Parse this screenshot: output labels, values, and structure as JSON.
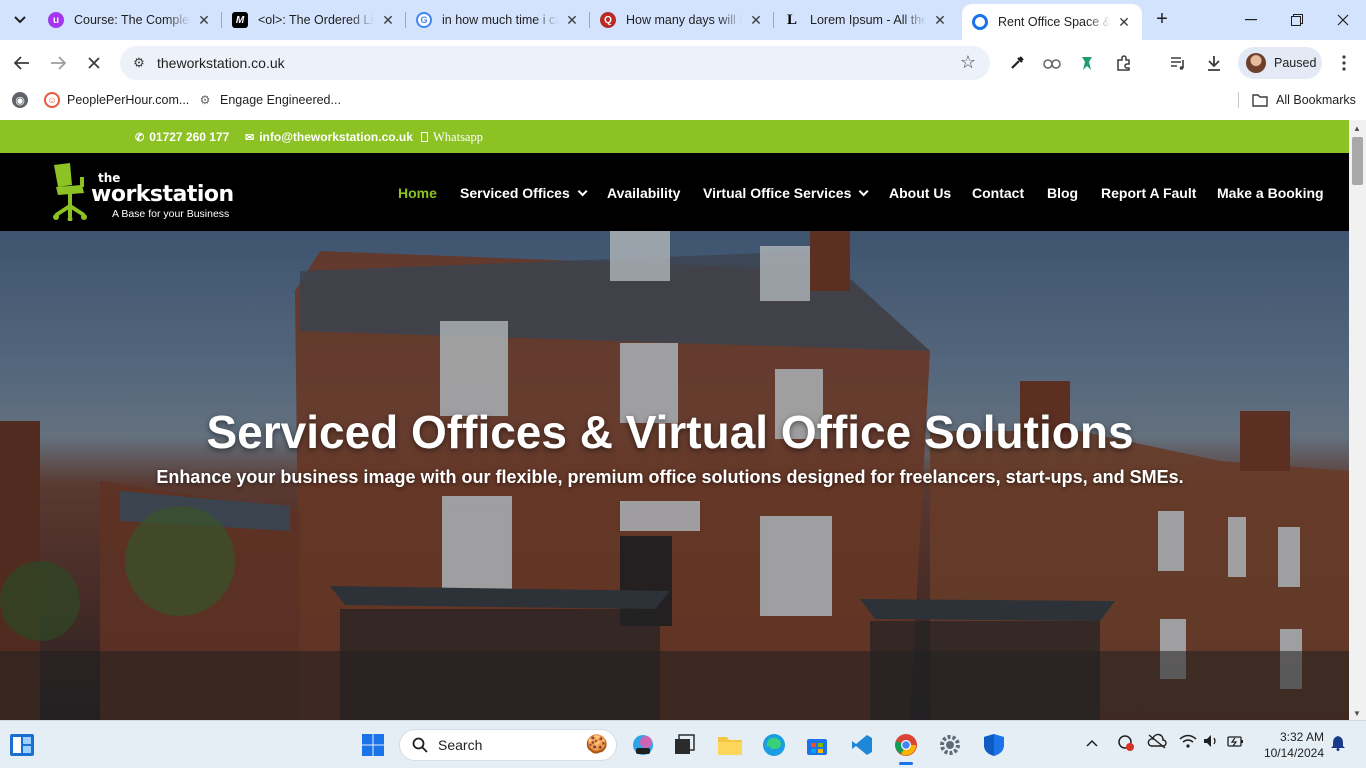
{
  "browser": {
    "tabs": [
      {
        "title": "Course: The Complete",
        "favicon": "udemy-icon",
        "color": "#a435f0"
      },
      {
        "title": "<ol>: The Ordered List",
        "favicon": "mdn-icon",
        "color": "#000000"
      },
      {
        "title": "in how much time i can",
        "favicon": "google-icon",
        "color": "#4285f4"
      },
      {
        "title": "How many days will it",
        "favicon": "quora-icon",
        "color": "#b92b27"
      },
      {
        "title": "Lorem Ipsum - All the",
        "favicon": "lipsum-icon",
        "color": "#000000"
      },
      {
        "title": "Rent Office Space & V",
        "favicon": "workstation-icon",
        "color": "#1a73e8",
        "active": true
      }
    ],
    "url": "theworkstation.co.uk",
    "profile_label": "Paused",
    "bookmarks": [
      {
        "label": "PeoplePerHour.com..."
      },
      {
        "label": "Engage Engineered..."
      }
    ],
    "all_bookmarks_label": "All Bookmarks"
  },
  "site": {
    "topbar": {
      "phone": "01727 260 177",
      "email": "info@theworkstation.co.uk",
      "whatsapp": "Whatsapp",
      "color": "#8cc224"
    },
    "logo": {
      "the": "the",
      "brand": "workstation",
      "tagline": "A Base for your Business"
    },
    "menu": [
      {
        "label": "Home",
        "current": true
      },
      {
        "label": "Serviced Offices",
        "dropdown": true
      },
      {
        "label": "Availability"
      },
      {
        "label": "Virtual Office Services",
        "dropdown": true
      },
      {
        "label": "About Us"
      },
      {
        "label": "Contact"
      },
      {
        "label": "Blog"
      },
      {
        "label": "Report A Fault"
      },
      {
        "label": "Make a Booking"
      }
    ],
    "hero": {
      "title": "Serviced Offices & Virtual Office Solutions",
      "subtitle": "Enhance your business image with our flexible, premium office solutions designed for freelancers, start-ups, and SMEs."
    }
  },
  "taskbar": {
    "search_label": "Search",
    "time": "3:32 AM",
    "date": "10/14/2024"
  }
}
